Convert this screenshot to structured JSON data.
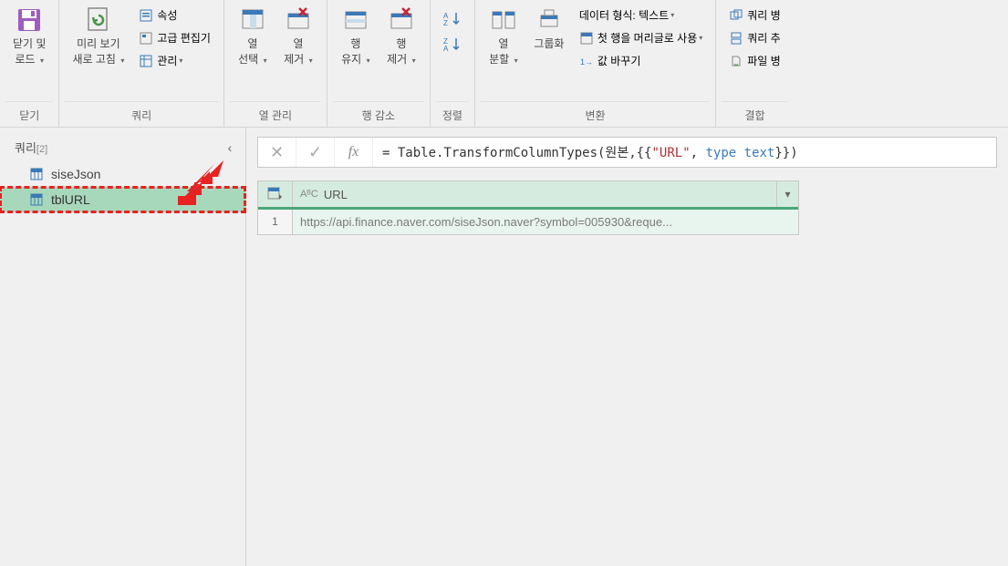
{
  "ribbon": {
    "close": {
      "label": "닫기 및\n로드",
      "group": "닫기"
    },
    "query": {
      "refresh": "미리 보기\n새로 고침",
      "properties": "속성",
      "advanced_editor": "고급 편집기",
      "manage": "관리",
      "group": "쿼리"
    },
    "columns": {
      "choose": "열\n선택",
      "remove": "열\n제거",
      "group": "열 관리"
    },
    "rows": {
      "keep": "행\n유지",
      "remove": "행\n제거",
      "group": "행 감소"
    },
    "sort": {
      "group": "정렬"
    },
    "transform": {
      "split": "열\n분할",
      "groupby": "그룹화",
      "datatype": "데이터 형식: 텍스트",
      "first_row_header": "첫 행을 머리글로 사용",
      "replace": "값 바꾸기",
      "group": "변환"
    },
    "combine": {
      "merge": "쿼리 병",
      "append": "쿼리 추",
      "files": "파일 병",
      "group": "결합"
    }
  },
  "sidebar": {
    "title": "쿼리",
    "count": "[2]",
    "items": [
      {
        "name": "siseJson"
      },
      {
        "name": "tblURL"
      }
    ]
  },
  "formula": {
    "prefix": "= Table.TransformColumnTypes(원본,{{",
    "str": "\"URL\"",
    "mid": ", ",
    "kw": "type text",
    "suffix": "}})"
  },
  "table": {
    "column_type": "AᴮC",
    "column_name": "URL",
    "rows": [
      {
        "num": "1",
        "value": "https://api.finance.naver.com/siseJson.naver?symbol=005930&reque..."
      }
    ]
  }
}
